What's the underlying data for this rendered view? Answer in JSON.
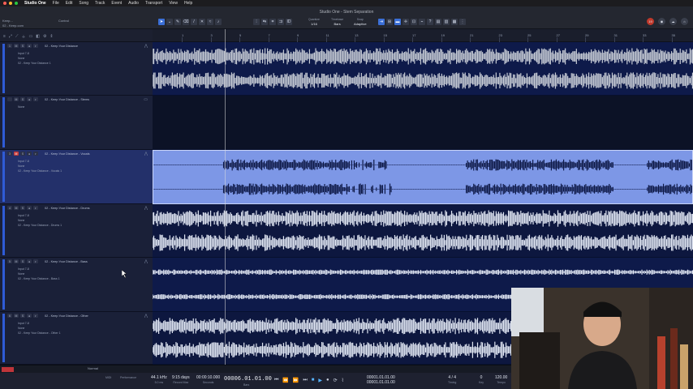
{
  "menubar": {
    "app_name": "Studio One",
    "items": [
      "File",
      "Edit",
      "Song",
      "Track",
      "Event",
      "Audio",
      "Transport",
      "View",
      "Help"
    ]
  },
  "window": {
    "title": "Studio One - Stem Separation"
  },
  "toolbar": {
    "song_label": "Keep...",
    "song_sub": "02 - Keep.com",
    "control_label": "Control",
    "fields": [
      {
        "label": "Quantize",
        "value": "1/16"
      },
      {
        "label": "Timebase",
        "value": "Bars"
      },
      {
        "label": "Snap",
        "value": "Adaptive"
      }
    ],
    "badge_count": "19"
  },
  "ruler": {
    "marks": [
      "1",
      "3",
      "5",
      "7",
      "9",
      "11",
      "13",
      "15",
      "17",
      "19",
      "21",
      "23",
      "25",
      "27",
      "29",
      "31",
      "33",
      "35",
      "37"
    ]
  },
  "tracks": [
    {
      "num": "1",
      "name": "02 - Keep Your Distance",
      "input": "Input 7-8",
      "send": "None",
      "output": "02 - Keep Your Distance 1",
      "type": "audio",
      "colors": "grey"
    },
    {
      "num": "",
      "name": "02 - Keep Your Distance - Stems",
      "input": "None",
      "send": "",
      "output": "",
      "type": "folder",
      "colors": "empty"
    },
    {
      "num": "3",
      "name": "02 - Keep Your Distance - Vocals",
      "input": "Input 7-8",
      "send": "None",
      "output": "02 - Keep Your Distance - Vocals 1",
      "type": "audio",
      "colors": "selected"
    },
    {
      "num": "4",
      "name": "02 - Keep Your Distance - Drums",
      "input": "Input 7-8",
      "send": "None",
      "output": "02 - Keep Your Distance - Drums 1",
      "type": "audio",
      "colors": "blue"
    },
    {
      "num": "5",
      "name": "02 - Keep Your Distance - Bass",
      "input": "Input 7-8",
      "send": "None",
      "output": "02 - Keep Your Distance - Bass 1",
      "type": "audio",
      "colors": "blue"
    },
    {
      "num": "6",
      "name": "02 - Keep Your Distance - Other",
      "input": "Input 7-8",
      "send": "None",
      "output": "02 - Keep Your Distance - Other 1",
      "type": "audio",
      "colors": "blue"
    }
  ],
  "status": {
    "mode": "Normal"
  },
  "transport": {
    "sample_rate": {
      "value": "44.1 kHz",
      "label": "5.0 ms"
    },
    "record_max": {
      "value": "9:15 days",
      "label": "Record Max"
    },
    "seconds": {
      "value": "00:00:10.000",
      "label": "Seconds"
    },
    "position": "00006.01.01.00",
    "position_label": "Bars",
    "loop_start": "00001.01.01.00",
    "loop_end": "00001.01.01.00",
    "time_sig": {
      "value": "4 / 4",
      "label": "Timing"
    },
    "key": {
      "value": "0",
      "label": "Key"
    },
    "tempo": {
      "value": "120.00",
      "label": "Tempo"
    },
    "perf_label": "Performance",
    "midi_label": "MIDI"
  }
}
